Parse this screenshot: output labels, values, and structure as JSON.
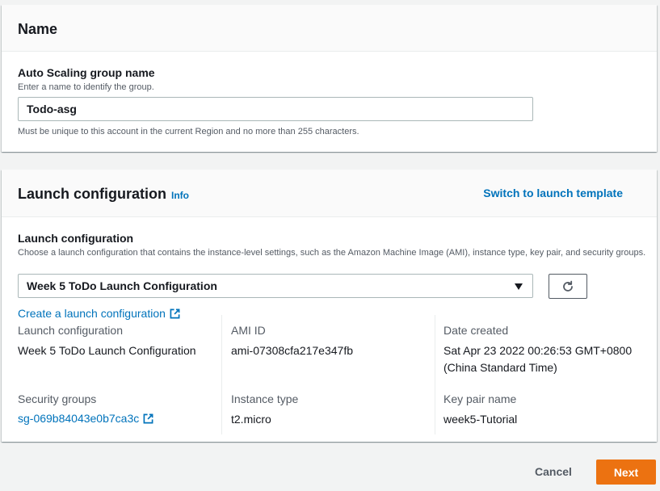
{
  "name_section": {
    "title": "Name",
    "field_label": "Auto Scaling group name",
    "field_desc": "Enter a name to identify the group.",
    "field_value": "Todo-asg",
    "field_constraint": "Must be unique to this account in the current Region and no more than 255 characters."
  },
  "launch_section": {
    "title": "Launch configuration",
    "info_label": "Info",
    "switch_link": "Switch to launch template",
    "field_label": "Launch configuration",
    "field_desc": "Choose a launch configuration that contains the instance-level settings, such as the Amazon Machine Image (AMI), instance type, key pair, and security groups.",
    "select_value": "Week 5 ToDo Launch Configuration",
    "create_link": "Create a launch configuration",
    "details": {
      "launch_config_key": "Launch configuration",
      "launch_config_val": "Week 5 ToDo Launch Configuration",
      "ami_key": "AMI ID",
      "ami_val": "ami-07308cfa217e347fb",
      "date_key": "Date created",
      "date_val_line1": "Sat Apr 23 2022 00:26:53 GMT+0800",
      "date_val_line2": "(China Standard Time)",
      "sg_key": "Security groups",
      "sg_val": "sg-069b84043e0b7ca3c",
      "instance_key": "Instance type",
      "instance_val": "t2.micro",
      "keypair_key": "Key pair name",
      "keypair_val": "week5-Tutorial"
    }
  },
  "footer": {
    "cancel_label": "Cancel",
    "next_label": "Next"
  },
  "colors": {
    "accent_orange": "#ec7211",
    "link_blue": "#0073bb"
  }
}
